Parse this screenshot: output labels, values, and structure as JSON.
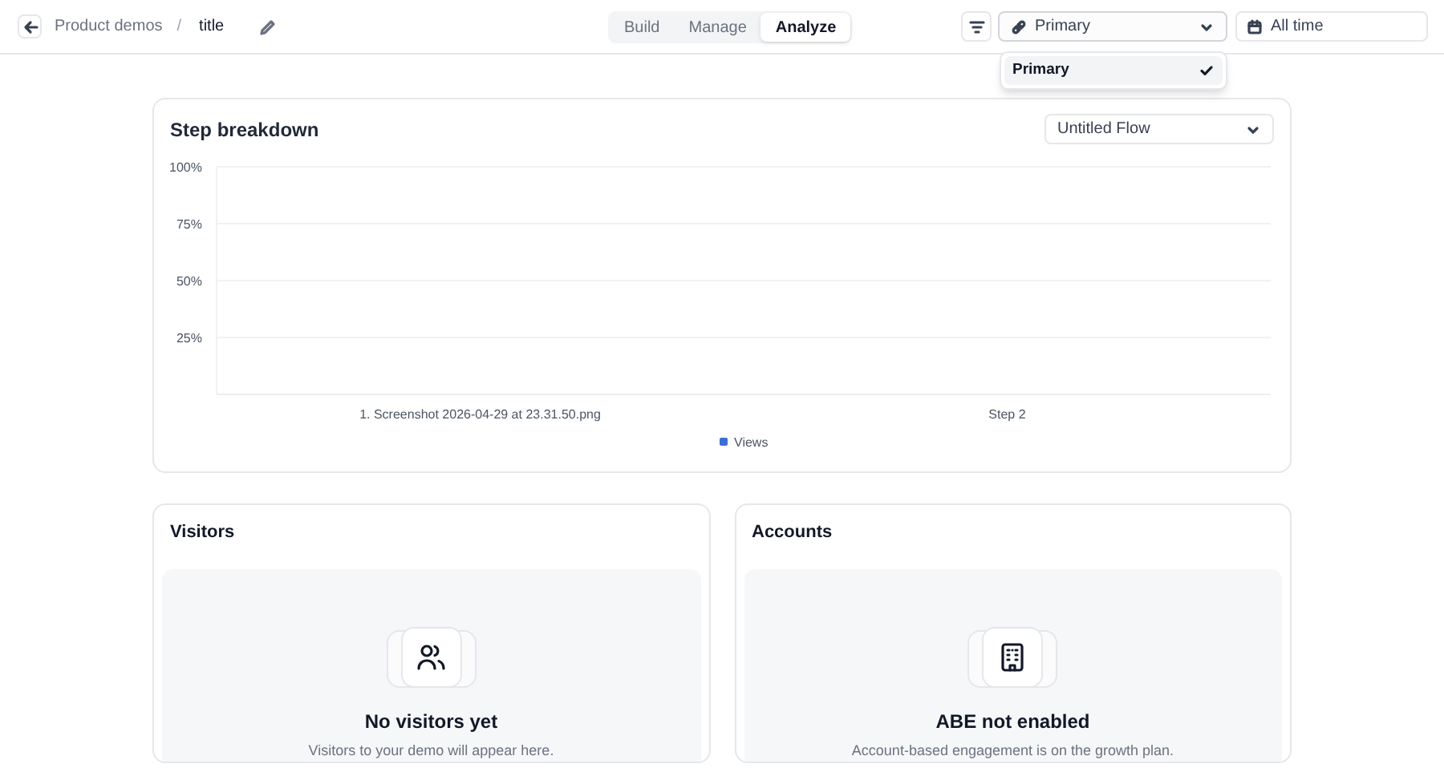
{
  "breadcrumb": {
    "parent": "Product demos",
    "separator": "/",
    "title": "title"
  },
  "tabs": [
    {
      "label": "Build",
      "selected": false
    },
    {
      "label": "Manage",
      "selected": false
    },
    {
      "label": "Analyze",
      "selected": true
    }
  ],
  "link_select": {
    "value": "Primary",
    "expanded": true,
    "options": [
      {
        "label": "Primary",
        "selected": true
      }
    ]
  },
  "date_range": {
    "value": "All time"
  },
  "step_breakdown": {
    "title": "Step breakdown",
    "flow_select": "Untitled Flow",
    "chart_data": {
      "type": "bar",
      "grid": true,
      "categories": [
        "1. Screenshot 2026-04-29 at 23.31.50.png",
        "Step 2"
      ],
      "series": [
        {
          "name": "Views",
          "color": "#3b6fd4",
          "values": [
            null,
            null
          ]
        }
      ],
      "ylim": [
        0,
        100
      ],
      "yticks": [
        {
          "value": 25,
          "label": "25%"
        },
        {
          "value": 50,
          "label": "50%"
        },
        {
          "value": 75,
          "label": "75%"
        },
        {
          "value": 100,
          "label": "100%"
        }
      ]
    }
  },
  "visitors": {
    "title": "Visitors",
    "empty_title": "No visitors yet",
    "empty_text": "Visitors to your demo will appear here."
  },
  "accounts": {
    "title": "Accounts",
    "empty_title": "ABE not enabled",
    "empty_text": "Account-based engagement is on the growth plan."
  }
}
